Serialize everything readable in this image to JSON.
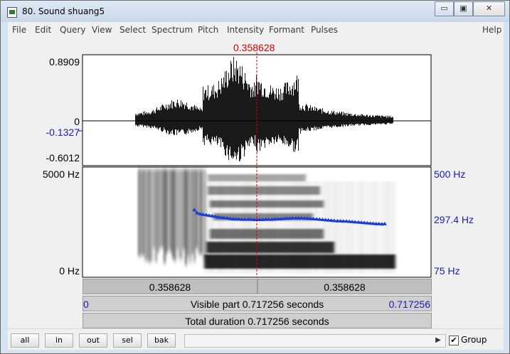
{
  "window": {
    "title": "80. Sound shuang5",
    "controls": {
      "minimize": "▭",
      "maximize": "▣",
      "close": "✕"
    }
  },
  "menu": [
    "File",
    "Edit",
    "Query",
    "View",
    "Select",
    "Spectrum",
    "Pitch",
    "Intensity",
    "Formant",
    "Pulses",
    "Help"
  ],
  "cursor": {
    "time_label": "0.358628",
    "fraction_of_visible": 0.5
  },
  "waveform": {
    "top_label": "0.8909",
    "zero_label": "0",
    "cursor_value_label": "-0.1327",
    "bottom_label": "-0.6012",
    "ymax": 0.8909,
    "ymin": -0.6012
  },
  "spectrogram": {
    "left_top_label": "5000 Hz",
    "left_bottom_label": "0 Hz",
    "right_top_label": "500 Hz",
    "right_value_label": "297.4 Hz",
    "right_bottom_label": "75 Hz",
    "pitch_max_hz": 500,
    "pitch_min_hz": 75,
    "pitch_at_cursor_hz": 297.4
  },
  "selection": {
    "left_label": "0.358628",
    "right_label": "0.358628"
  },
  "visible": {
    "start": "0",
    "text": "Visible part 0.717256 seconds",
    "end": "0.717256"
  },
  "total": {
    "text": "Total duration 0.717256 seconds"
  },
  "buttons": {
    "all": "all",
    "in": "in",
    "out": "out",
    "sel": "sel",
    "bak": "bak"
  },
  "group": {
    "label": "Group",
    "checked": true
  },
  "colors": {
    "cursor": "#d40000",
    "pitch": "#1a3fd8",
    "blue_text": "#1a1ab8"
  },
  "pitch_track": {
    "time": [
      0.23,
      0.236,
      0.242,
      0.248,
      0.255,
      0.261,
      0.267,
      0.273,
      0.279,
      0.285,
      0.291,
      0.298,
      0.304,
      0.31,
      0.316,
      0.322,
      0.328,
      0.334,
      0.341,
      0.347,
      0.353,
      0.359,
      0.365,
      0.371,
      0.377,
      0.383,
      0.39,
      0.396,
      0.402,
      0.408,
      0.414,
      0.42,
      0.426,
      0.432,
      0.439,
      0.445,
      0.451,
      0.457,
      0.463,
      0.469,
      0.475,
      0.482,
      0.488,
      0.494,
      0.5,
      0.506,
      0.512,
      0.518,
      0.525,
      0.531,
      0.537,
      0.543,
      0.549,
      0.555,
      0.561,
      0.568,
      0.574,
      0.58,
      0.586,
      0.592,
      0.598,
      0.604,
      0.61,
      0.616,
      0.622
    ],
    "f0": [
      335,
      323,
      319,
      317,
      315,
      313,
      311,
      309,
      307,
      305,
      304,
      303,
      301,
      300,
      299,
      299,
      298,
      298,
      298,
      298,
      297,
      297,
      297,
      297,
      298,
      298,
      298,
      299,
      300,
      300,
      301,
      302,
      302,
      303,
      303,
      303,
      303,
      302,
      302,
      301,
      300,
      299,
      298,
      297,
      296,
      295,
      294,
      293,
      292,
      292,
      291,
      291,
      290,
      289,
      288,
      287,
      286,
      285,
      284,
      283,
      282,
      281,
      281,
      280,
      281
    ]
  }
}
